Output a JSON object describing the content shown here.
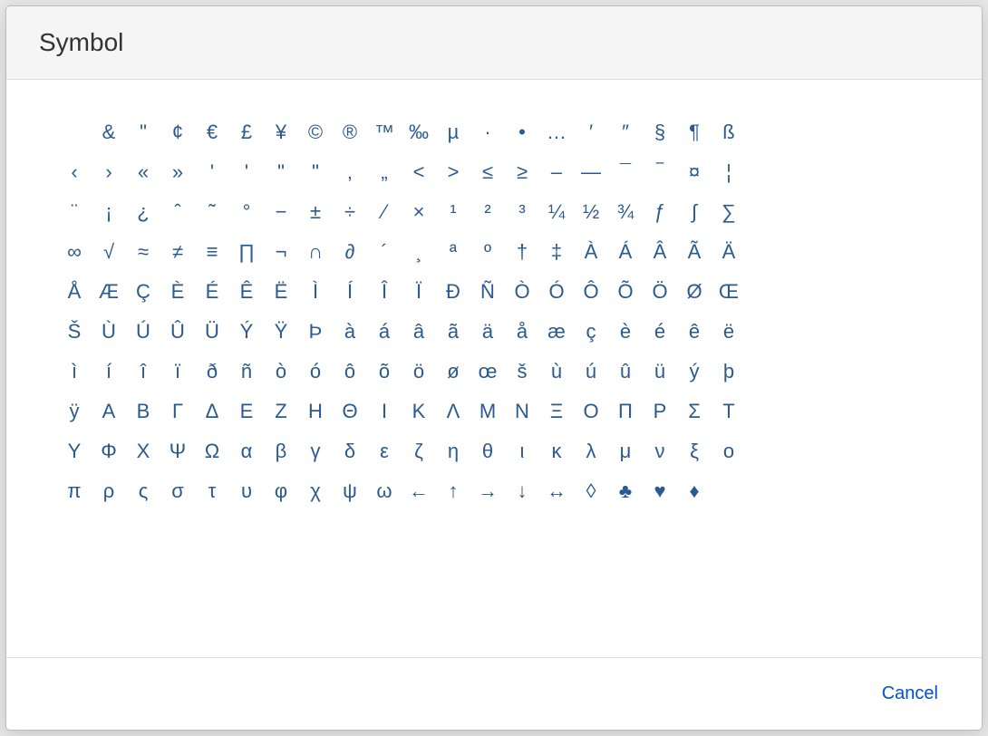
{
  "dialog": {
    "title": "Symbol",
    "cancel_label": "Cancel"
  },
  "symbols": [
    "&",
    "\"",
    "¢",
    "€",
    "£",
    "¥",
    "©",
    "®",
    "™",
    "‰",
    "µ",
    "·",
    "•",
    "…",
    "′",
    "″",
    "§",
    "¶",
    "ß",
    "‹",
    "›",
    "«",
    "»",
    "'",
    "'",
    "\"",
    "\"",
    "‚",
    "„",
    "<",
    ">",
    "≤",
    "≥",
    "–",
    "—",
    "¯",
    "‾",
    "¤",
    "¦",
    "¨",
    "¡",
    "¿",
    "ˆ",
    "˜",
    "°",
    "−",
    "±",
    "÷",
    "⁄",
    "×",
    "¹",
    "²",
    "³",
    "¼",
    "½",
    "¾",
    "ƒ",
    "∫",
    "∑",
    "∞",
    "√",
    "≈",
    "≠",
    "≡",
    "∏",
    "¬",
    "∩",
    "∂",
    "´",
    "¸",
    "ª",
    "º",
    "†",
    "‡",
    "À",
    "Á",
    "Â",
    "Ã",
    "Ä",
    "Å",
    "Æ",
    "Ç",
    "È",
    "É",
    "Ê",
    "Ë",
    "Ì",
    "Í",
    "Î",
    "Ï",
    "Đ",
    "Ñ",
    "Ò",
    "Ó",
    "Ô",
    "Õ",
    "Ö",
    "Ø",
    "Œ",
    "Š",
    "Ù",
    "Ú",
    "Û",
    "Ü",
    "Ý",
    "Ÿ",
    "Þ",
    "à",
    "á",
    "â",
    "ã",
    "ä",
    "å",
    "æ",
    "ç",
    "è",
    "é",
    "ê",
    "ë",
    "ì",
    "í",
    "î",
    "ï",
    "ð",
    "ñ",
    "ò",
    "ó",
    "ô",
    "õ",
    "ö",
    "ø",
    "œ",
    "š",
    "ù",
    "ú",
    "û",
    "ü",
    "ý",
    "þ",
    "ÿ",
    "Α",
    "Β",
    "Γ",
    "Δ",
    "Ε",
    "Ζ",
    "Η",
    "Θ",
    "Ι",
    "Κ",
    "Λ",
    "Μ",
    "Ν",
    "Ξ",
    "Ο",
    "Π",
    "Ρ",
    "Σ",
    "Τ",
    "Υ",
    "Φ",
    "Χ",
    "Ψ",
    "Ω",
    "α",
    "β",
    "γ",
    "δ",
    "ε",
    "ζ",
    "η",
    "θ",
    "ι",
    "κ",
    "λ",
    "μ",
    "ν",
    "ξ",
    "ο",
    "π",
    "ρ",
    "ς",
    "σ",
    "τ",
    "υ",
    "φ",
    "χ",
    "ψ",
    "ω",
    "←",
    "↑",
    "→",
    "↓",
    "↔",
    "◊",
    "♣",
    "♥",
    "♦"
  ]
}
